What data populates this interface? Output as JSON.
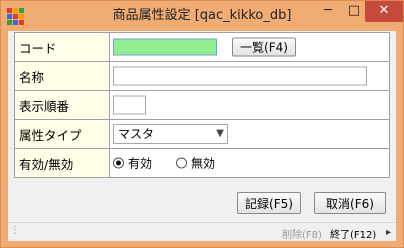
{
  "window": {
    "title": "商品属性設定 [qac_kikko_db]",
    "minimize_glyph": "─",
    "maximize_glyph": "□",
    "close_glyph": "✕",
    "accent_color": "#f0ac73",
    "close_color": "#c7493e"
  },
  "form": {
    "code": {
      "label": "コード",
      "value": "",
      "lookup_button": "一覧(F4)",
      "fill_color": "#90ee90"
    },
    "name": {
      "label": "名称",
      "value": ""
    },
    "display_order": {
      "label": "表示順番",
      "value": ""
    },
    "attribute_type": {
      "label": "属性タイプ",
      "selected": "マスタ",
      "arrow_icon": "chevron-down-icon"
    },
    "active": {
      "label": "有効/無効",
      "options": [
        {
          "label": "有効",
          "selected": true
        },
        {
          "label": "無効",
          "selected": false
        }
      ]
    }
  },
  "actions": {
    "save": "記録(F5)",
    "cancel": "取消(F6)"
  },
  "statusbar": {
    "delete": "削除(F8)",
    "exit": "終了(F12)"
  }
}
